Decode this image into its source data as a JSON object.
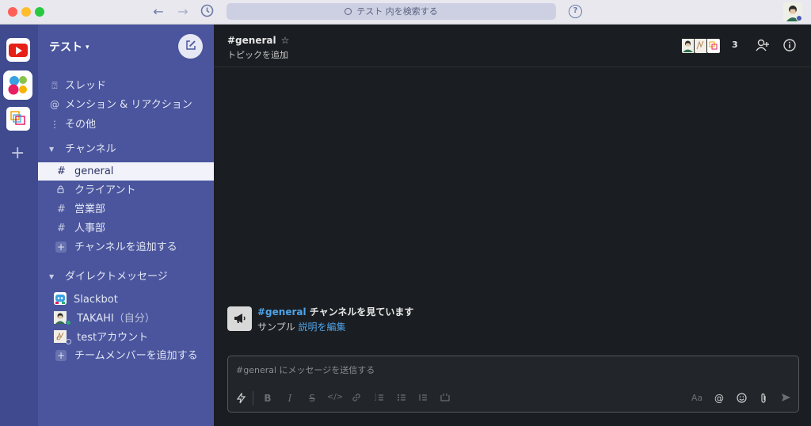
{
  "titlebar": {
    "search_text": "テスト 内を検索する",
    "help_label": "?"
  },
  "sidebar": {
    "team_name": "テスト",
    "nav": [
      {
        "label": "スレッド",
        "icon": "threads-icon"
      },
      {
        "label": "メンション & リアクション",
        "icon": "at-icon"
      },
      {
        "label": "その他",
        "icon": "more-vertical-icon"
      }
    ],
    "channels_header": "チャンネル",
    "channels": [
      {
        "label": "general",
        "prefix": "#",
        "selected": true
      },
      {
        "label": "クライアント",
        "prefix": "🔒",
        "selected": false
      },
      {
        "label": "営業部",
        "prefix": "#",
        "selected": false
      },
      {
        "label": "人事部",
        "prefix": "#",
        "selected": false
      }
    ],
    "add_channel": "チャンネルを追加する",
    "dm_header": "ダイレクトメッセージ",
    "dms": [
      {
        "label": "Slackbot",
        "suffix": ""
      },
      {
        "label": "TAKAHI",
        "suffix": "（自分）"
      },
      {
        "label": "testアカウント",
        "suffix": ""
      }
    ],
    "add_member": "チームメンバーを追加する"
  },
  "header": {
    "channel_name": "#general",
    "star": "☆",
    "topic": "トピックを追加",
    "member_count": "3"
  },
  "intro": {
    "channel_link": "#general",
    "title_rest": " チャンネルを見ています",
    "desc_prefix": "サンプル ",
    "desc_link": "説明を編集"
  },
  "composer": {
    "placeholder": "#general にメッセージを送信する",
    "aa_label": "Aa"
  },
  "colors": {
    "sidebar": "#4a559d",
    "rail": "#3f4a8f",
    "main": "#1a1d21",
    "link": "#4fa3e8",
    "online": "#2bac76"
  }
}
